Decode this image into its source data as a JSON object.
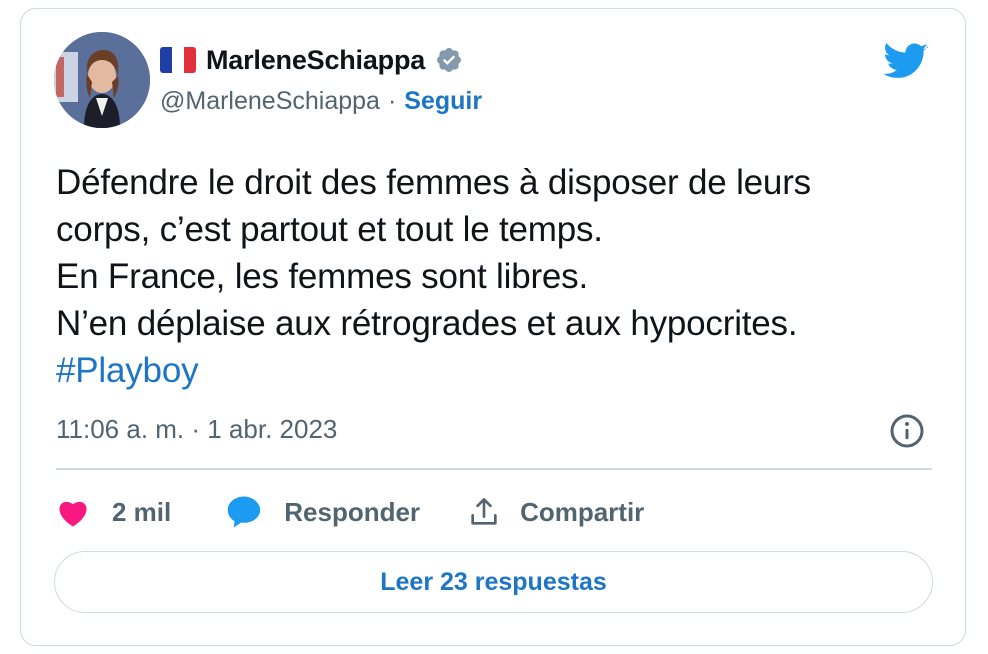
{
  "author": {
    "name": "MarleneSchiappa",
    "handle": "@MarleneSchiappa",
    "separator": "·",
    "follow_label": "Seguir",
    "avatar_icon": "profile-photo",
    "flag_icon": "france-flag",
    "verified_icon": "verified-badge-icon"
  },
  "tweet": {
    "lines": [
      "Défendre le droit des femmes à disposer de leurs",
      "corps, c’est partout et tout le temps.",
      "En France, les femmes sont libres.",
      "N’en déplaise aux rétrogrades et aux hypocrites."
    ],
    "hashtag": "#Playboy",
    "timestamp": "11:06 a. m. · 1 abr. 2023"
  },
  "actions": {
    "like_count": "2 mil",
    "reply_label": "Responder",
    "share_label": "Compartir"
  },
  "read_replies_label": "Leer 23 respuestas",
  "colors": {
    "accent": "#1d75c6",
    "twitter_blue": "#1d9bf0",
    "like_pink": "#f91880",
    "muted": "#536471",
    "border": "#cfd9de"
  }
}
